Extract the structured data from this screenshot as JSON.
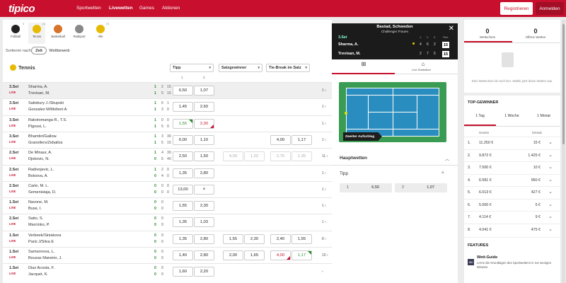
{
  "header": {
    "logo": "tipico",
    "nav": [
      "Sportwetten",
      "Livewetten",
      "Games",
      "Aktionen"
    ],
    "active_nav": "Livewetten",
    "register_label": "Registrieren",
    "login_label": "Anmelden",
    "brand_color": "#c8102e"
  },
  "sports": [
    {
      "label": "Fußball",
      "count": "3",
      "icon": "football-icon",
      "color": "#222222"
    },
    {
      "label": "Tennis",
      "count": "13",
      "icon": "tennis-ball-icon",
      "color": "#e7b900"
    },
    {
      "label": "Basketball",
      "count": "",
      "icon": "basketball-icon",
      "color": "#d8742a"
    },
    {
      "label": "Radsport",
      "count": "",
      "icon": "cycling-icon",
      "color": "#888888"
    },
    {
      "label": "Alle",
      "count": "19",
      "icon": "all-sports-icon",
      "color": "#e7b900"
    }
  ],
  "sort": {
    "label": "Sortieren nach:",
    "options": [
      "Zeit",
      "Wettbewerb"
    ],
    "selected": "Zeit"
  },
  "section": {
    "title": "Tennis"
  },
  "markets": [
    {
      "label": "Tipp",
      "cols": [
        "1",
        "2"
      ]
    },
    {
      "label": "Satzgewinner",
      "cols": []
    },
    {
      "label": "Tie-Break im Satz",
      "cols": []
    }
  ],
  "matches": [
    {
      "set": "3.Set",
      "live": "LIVE",
      "p1": "Sharma, A.",
      "p2": "Trevisan, M.",
      "s1": [
        "1",
        "2",
        "15"
      ],
      "s2": [
        "1",
        "5",
        "15"
      ],
      "odds": [
        {
          "v": "6,50"
        },
        {
          "v": "1,07"
        }
      ],
      "more": "1"
    },
    {
      "set": "3.Set",
      "live": "LIVE",
      "p1": "Salisbury J./Skupski",
      "p2": "Gonzalez M/Molteni A",
      "s1": [
        "1",
        "6",
        "1"
      ],
      "s2": [
        "1",
        "3",
        "0"
      ],
      "odds": [
        {
          "v": "1,45"
        },
        {
          "v": "2,60"
        }
      ],
      "more": "1"
    },
    {
      "set": "3.Set",
      "live": "LIVE",
      "p1": "Rakotomanga R., T.S.",
      "p2": "Pigossi, L.",
      "s1": [
        "1",
        "0",
        "0"
      ],
      "s2": [
        "1",
        "5",
        "0"
      ],
      "odds": [
        {
          "v": "1,55",
          "t": "up"
        },
        {
          "v": "2,30",
          "t": "down"
        }
      ],
      "more": "1"
    },
    {
      "set": "3.Set",
      "live": "LIVE",
      "p1": "Bhambri/Gallow.",
      "p2": "Granollers/Zeballos",
      "s1": [
        "1",
        "3",
        "30"
      ],
      "s2": [
        "1",
        "5",
        "15"
      ],
      "odds": [
        {
          "v": "6,00"
        },
        {
          "v": "1,10"
        }
      ],
      "tb": [
        {
          "v": "4,00"
        },
        {
          "v": "1,17"
        }
      ],
      "more": "1"
    },
    {
      "set": "2.Set",
      "live": "LIVE",
      "p1": "De Minaur, A.",
      "p2": "Djokovic, N.",
      "s1": [
        "1",
        "4",
        "30"
      ],
      "s2": [
        "0",
        "5",
        "40"
      ],
      "odds": [
        {
          "v": "2,50"
        },
        {
          "v": "1,50"
        }
      ],
      "sg": [
        {
          "v": "4,00",
          "t": "light"
        },
        {
          "v": "1,22",
          "t": "light"
        }
      ],
      "tb": [
        {
          "v": "2,75",
          "t": "light"
        },
        {
          "v": "1,35",
          "t": "light"
        }
      ],
      "more": "11"
    },
    {
      "set": "2.Set",
      "live": "LIVE",
      "p1": "Radivojevic, L.",
      "p2": "Bolsova, A.",
      "s1": [
        "1",
        "2",
        "0"
      ],
      "s2": [
        "0",
        "4",
        "0"
      ],
      "odds": [
        {
          "v": "1,35"
        },
        {
          "v": "2,80"
        }
      ],
      "more": "1"
    },
    {
      "set": "2.Set",
      "live": "LIVE",
      "p1": "Carle, M. L.",
      "p2": "Semenistaja, D.",
      "s1": [
        "0",
        "0",
        "0"
      ],
      "s2": [
        "0",
        "0",
        "0"
      ],
      "odds": [
        {
          "v": "13,00"
        },
        {
          "v": "",
          "t": "lock"
        }
      ],
      "more": "1"
    },
    {
      "set": "1.Set",
      "live": "LIVE",
      "p1": "Navone, M.",
      "p2": "Buse, I.",
      "s1": [
        "0",
        "0"
      ],
      "s2": [
        "0",
        "0"
      ],
      "odds": [
        {
          "v": "1,55"
        },
        {
          "v": "2,30"
        }
      ],
      "more": "1"
    },
    {
      "set": "2.Set",
      "live": "LIVE",
      "p1": "Saito, S.",
      "p2": "Marcinko, P.",
      "s1": [
        "0",
        "0"
      ],
      "s2": [
        "0",
        "0"
      ],
      "odds": [
        {
          "v": "1,35"
        },
        {
          "v": "1,03"
        }
      ],
      "more": "1"
    },
    {
      "set": "1.Set",
      "live": "LIVE",
      "p1": "Verbeek/Siniakova",
      "p2": "Paris J/Silva E",
      "s1": [
        "0",
        "0"
      ],
      "s2": [
        "0",
        "0"
      ],
      "odds": [
        {
          "v": "1,35"
        },
        {
          "v": "2,80"
        }
      ],
      "sg": [
        {
          "v": "1,55"
        },
        {
          "v": "2,30"
        }
      ],
      "tb": [
        {
          "v": "2,40"
        },
        {
          "v": "1,55"
        }
      ],
      "more": "8"
    },
    {
      "set": "1.Set",
      "live": "LIVE",
      "p1": "Samsonova, L.",
      "p2": "Bouzas Maneiro, J.",
      "s1": [
        "0",
        "0"
      ],
      "s2": [
        "0",
        "0"
      ],
      "odds": [
        {
          "v": "1,40"
        },
        {
          "v": "2,80"
        }
      ],
      "sg": [
        {
          "v": "2,00"
        },
        {
          "v": "1,65"
        }
      ],
      "tb": [
        {
          "v": "4,00",
          "t": "down"
        },
        {
          "v": "1,17",
          "t": "up"
        }
      ],
      "more": "10"
    },
    {
      "set": "1.Set",
      "live": "LIVE",
      "p1": "Diaz Acosta, F.",
      "p2": "Jacquet, K.",
      "s1": [
        "0",
        "0"
      ],
      "s2": [
        "0",
        "0"
      ],
      "odds": [
        {
          "v": "1,60"
        },
        {
          "v": "2,20"
        }
      ],
      "more": ""
    }
  ],
  "popup": {
    "title": "Bastad, Schweden",
    "subtitle": "Challenger Frauen",
    "set": "3.Set",
    "col_heads": [
      "1.",
      "2.",
      "3.",
      "Pkte"
    ],
    "p1": {
      "name": "Sharma, A.",
      "sets": [
        "4",
        "6",
        "2"
      ],
      "pts": "15"
    },
    "p2": {
      "name": "Trevisan, M.",
      "sets": [
        "2",
        "7",
        "5"
      ],
      "pts": "15"
    },
    "tab2": "Live-Statistiken",
    "banner": "Zweiter Aufschlag",
    "hauptwetten": "Hauptwetten",
    "tipp": "Tipp",
    "picks": [
      {
        "k": "1",
        "v": "6,50"
      },
      {
        "k": "2",
        "v": "1,07"
      }
    ]
  },
  "betslip": {
    "tabs": [
      {
        "n": "0",
        "l": "Wettschein"
      },
      {
        "n": "0",
        "l": "Offene Wetten"
      }
    ],
    "empty": "Dein Wettschein ist noch leer. Wähle jetzt deine Wetten aus."
  },
  "topwinners": {
    "title": "TOP-GEWINNER",
    "tabs": [
      "1 Tag",
      "1 Woche",
      "1 Monat"
    ],
    "col_gewinn": "Gewinn",
    "col_einsatz": "Einsatz",
    "rows": [
      {
        "r": "1.",
        "g": "11.250 €",
        "e": "15 €"
      },
      {
        "r": "2.",
        "g": "9.872 €",
        "e": "1.425 €"
      },
      {
        "r": "3.",
        "g": "7.500 €",
        "e": "10 €"
      },
      {
        "r": "4.",
        "g": "6.581 €",
        "e": "950 €"
      },
      {
        "r": "5.",
        "g": "6.013 €",
        "e": "427 €"
      },
      {
        "r": "6.",
        "g": "5.000 €",
        "e": "5 €"
      },
      {
        "r": "7.",
        "g": "4.114 €",
        "e": "9 €"
      },
      {
        "r": "8.",
        "g": "4.041 €",
        "e": "475 €"
      }
    ]
  },
  "features": {
    "title": "FEATURES",
    "icon_text": "360",
    "item_title": "Wett-Guide",
    "item_desc": "Lerne die Grundlagen des Sportwettens in nur wenigen Minuten."
  }
}
